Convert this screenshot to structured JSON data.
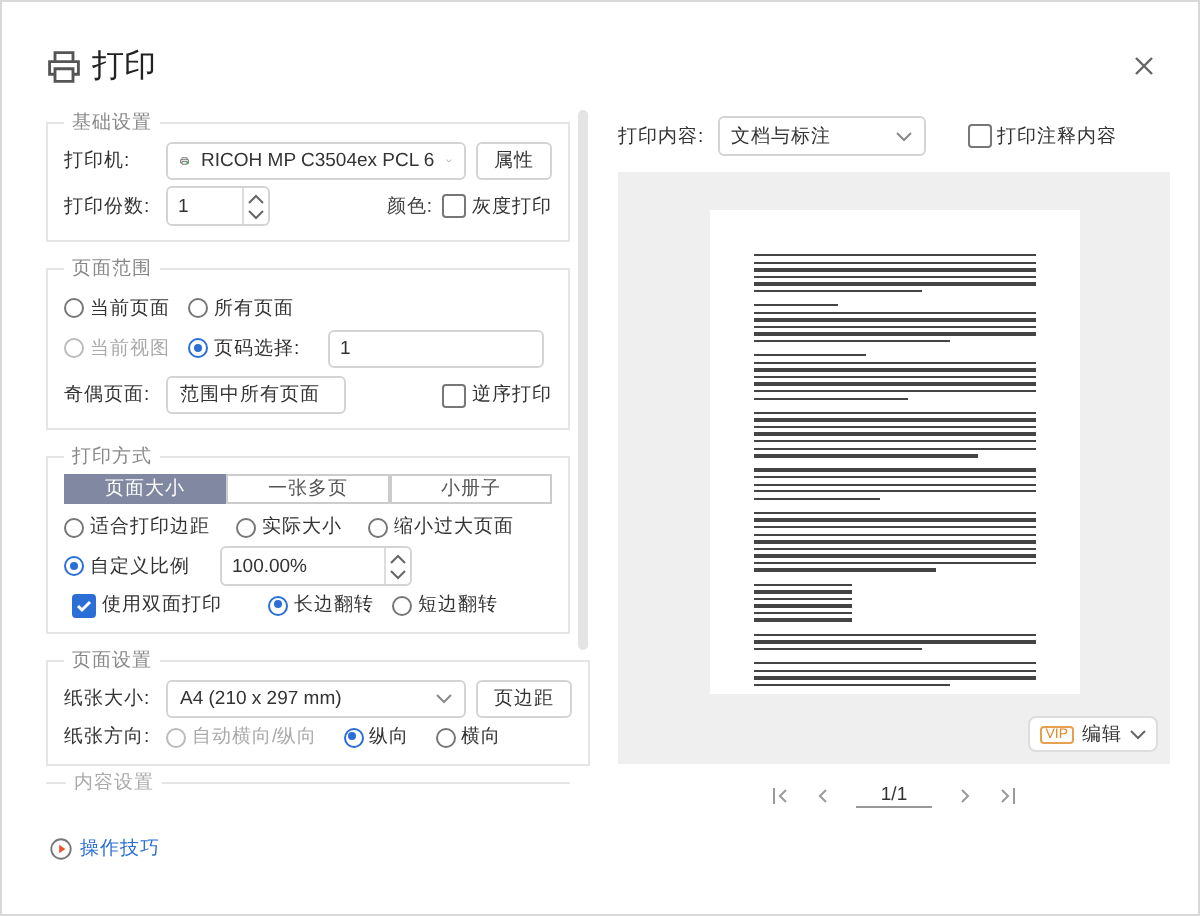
{
  "title": "打印",
  "basic": {
    "legend": "基础设置",
    "printer_label": "打印机:",
    "printer": "RICOH MP C3504ex PCL 6",
    "properties_button": "属性",
    "copies_label": "打印份数:",
    "copies": "1",
    "color_label": "颜色:",
    "grayscale": {
      "label": "灰度打印",
      "checked": false
    }
  },
  "page_range": {
    "legend": "页面范围",
    "options": [
      {
        "label": "当前页面",
        "selected": false,
        "disabled": false
      },
      {
        "label": "所有页面",
        "selected": false,
        "disabled": false
      },
      {
        "label": "当前视图",
        "selected": false,
        "disabled": true
      },
      {
        "label": "页码选择:",
        "selected": true,
        "disabled": false
      }
    ],
    "page_input": "1",
    "odd_even_label": "奇偶页面:",
    "odd_even": "范围中所有页面",
    "reverse": {
      "label": "逆序打印",
      "checked": false
    }
  },
  "print_mode": {
    "legend": "打印方式",
    "tabs": [
      {
        "label": "页面大小",
        "selected": true
      },
      {
        "label": "一张多页",
        "selected": false
      },
      {
        "label": "小册子",
        "selected": false
      }
    ],
    "scale_options": [
      {
        "label": "适合打印边距",
        "selected": false
      },
      {
        "label": "实际大小",
        "selected": false
      },
      {
        "label": "缩小过大页面",
        "selected": false
      },
      {
        "label": "自定义比例",
        "selected": true
      }
    ],
    "scale": "100.00%",
    "duplex": {
      "label": "使用双面打印",
      "checked": true
    },
    "flip_options": [
      {
        "label": "长边翻转",
        "selected": true
      },
      {
        "label": "短边翻转",
        "selected": false
      }
    ]
  },
  "page_setup": {
    "legend": "页面设置",
    "paper_label": "纸张大小:",
    "paper": "A4 (210 x 297 mm)",
    "margins_button": "页边距",
    "orientation_label": "纸张方向:",
    "orientations": [
      {
        "label": "自动横向/纵向",
        "selected": false,
        "disabled": true
      },
      {
        "label": "纵向",
        "selected": true,
        "disabled": false
      },
      {
        "label": "横向",
        "selected": false,
        "disabled": false
      }
    ]
  },
  "content_settings": {
    "legend": "内容设置"
  },
  "tips_link": "操作技巧",
  "preview": {
    "content_label": "打印内容:",
    "content": "文档与标注",
    "annotations": {
      "label": "打印注释内容",
      "checked": false
    },
    "vip_badge": "VIP",
    "edit_button": "编辑",
    "page": "1/1"
  }
}
